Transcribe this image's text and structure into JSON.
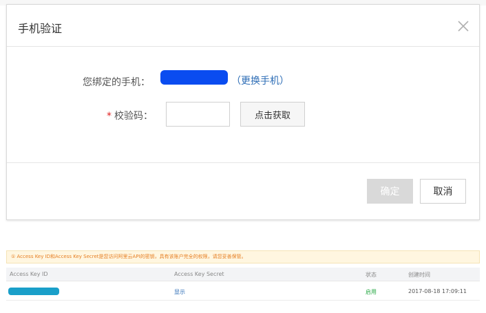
{
  "modal": {
    "title": "手机验证",
    "phone_label": "您绑定的手机：",
    "change_phone_link": "（更换手机）",
    "code_label": "校验码：",
    "required_mark": "*",
    "code_value": "",
    "get_code_button": "点击获取",
    "confirm_button": "确定",
    "cancel_button": "取消"
  },
  "notice": {
    "text": "① Access Key ID和Access Key Secret是您访问阿里云API的密钥，具有该账户完全的权限，请您妥善保管。"
  },
  "table": {
    "columns": [
      "Access Key ID",
      "Access Key Secret",
      "状态",
      "创建时间"
    ],
    "rows": [
      {
        "secret_action": "显示",
        "status": "启用",
        "created": "2017-08-18 17:09:11"
      }
    ]
  },
  "colors": {
    "phone_mask": "#0a4cf0",
    "key_mask": "#1a9fc9",
    "link": "#2d6db6",
    "status_green": "#27a844",
    "required_red": "#e02020",
    "notice_orange": "#e67e22"
  },
  "icons": {
    "close": "close-icon"
  }
}
